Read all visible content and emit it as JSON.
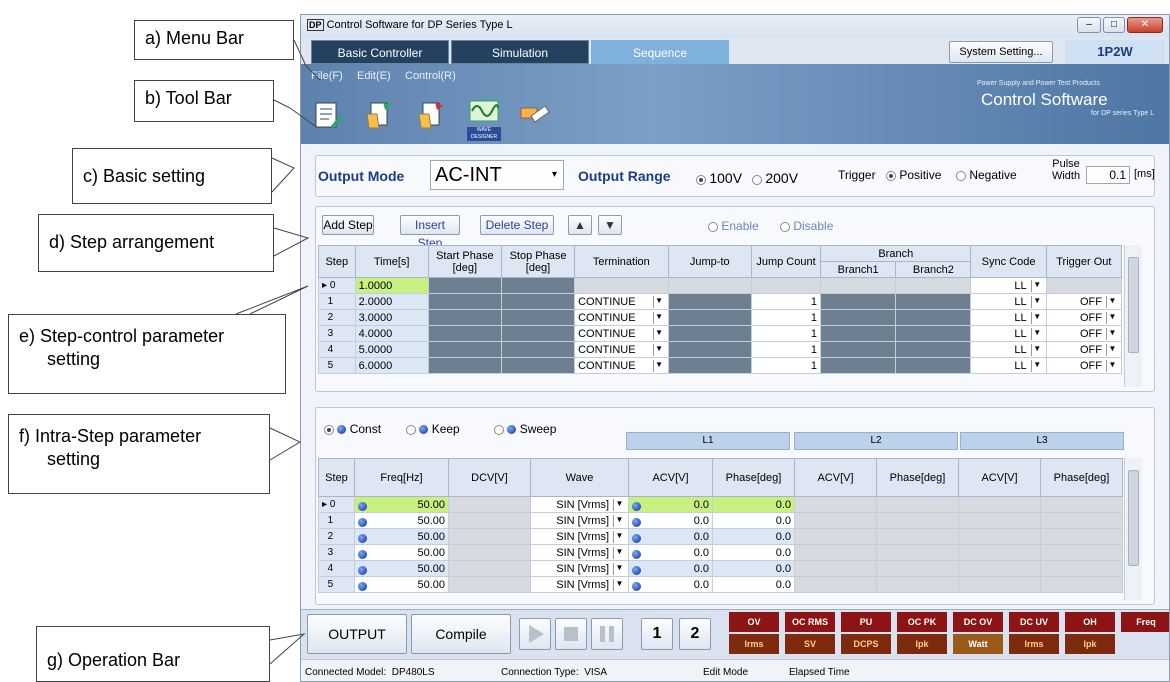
{
  "callouts": {
    "a": "a) Menu Bar",
    "b": "b) Tool Bar",
    "c": "c) Basic setting",
    "d": "d) Step arrangement",
    "e1": "e) Step-control parameter",
    "e2": "setting",
    "f1": "f) Intra-Step parameter",
    "f2": "setting",
    "g": "g) Operation Bar"
  },
  "window": {
    "title": "Control Software for DP Series Type L",
    "title_icon": "DP",
    "min": "–",
    "max": "□",
    "close": "✕"
  },
  "tabs": [
    "Basic Controller",
    "Simulation",
    "Sequence"
  ],
  "system_setting": "System Setting...",
  "phase_mode": "1P2W",
  "menu": [
    "File(F)",
    "Edit(E)",
    "Control(R)"
  ],
  "brand": {
    "small": "Power Supply and Power Test Products",
    "big": "Control Software",
    "sub": "for DP series Type L"
  },
  "tool_icons": [
    "edit-sheet-icon",
    "open-file-icon",
    "save-file-icon",
    "wave-designer-icon",
    "eraser-icon"
  ],
  "wave_designer_label": "WAVE DESIGNER",
  "basic": {
    "output_mode_label": "Output Mode",
    "output_mode_value": "AC-INT",
    "output_range_label": "Output Range",
    "range_100": "100V",
    "range_200": "200V",
    "trigger_label": "Trigger",
    "positive": "Positive",
    "negative": "Negative",
    "pulse_width_label": "Pulse Width",
    "pulse_width_value": "0.1",
    "pulse_unit": "[ms]"
  },
  "step_buttons": {
    "add": "Add Step",
    "insert": "Insert Step",
    "delete": "Delete Step",
    "up": "▲",
    "down": "▼",
    "enable": "Enable",
    "disable": "Disable"
  },
  "step_table": {
    "headers": [
      "Step",
      "Time[s]",
      "Start Phase [deg]",
      "Stop Phase [deg]",
      "Termination",
      "Jump-to",
      "Jump Count",
      "Branch",
      "Sync Code",
      "Trigger Out"
    ],
    "branch_sub": [
      "Branch1",
      "Branch2"
    ],
    "rows": [
      {
        "step": "0",
        "time": "1.0000",
        "term": "",
        "count": "",
        "sync": "LL",
        "trig": ""
      },
      {
        "step": "1",
        "time": "2.0000",
        "term": "CONTINUE",
        "count": "1",
        "sync": "LL",
        "trig": "OFF"
      },
      {
        "step": "2",
        "time": "3.0000",
        "term": "CONTINUE",
        "count": "1",
        "sync": "LL",
        "trig": "OFF"
      },
      {
        "step": "3",
        "time": "4.0000",
        "term": "CONTINUE",
        "count": "1",
        "sync": "LL",
        "trig": "OFF"
      },
      {
        "step": "4",
        "time": "5.0000",
        "term": "CONTINUE",
        "count": "1",
        "sync": "LL",
        "trig": "OFF"
      },
      {
        "step": "5",
        "time": "6.0000",
        "term": "CONTINUE",
        "count": "1",
        "sync": "LL",
        "trig": "OFF"
      }
    ]
  },
  "intra_modes": {
    "const": "Const",
    "keep": "Keep",
    "sweep": "Sweep"
  },
  "phase_groups": [
    "L1",
    "L2",
    "L3"
  ],
  "intra_table": {
    "headers": [
      "Step",
      "Freq[Hz]",
      "DCV[V]",
      "Wave",
      "ACV[V]",
      "Phase[deg]",
      "ACV[V]",
      "Phase[deg]",
      "ACV[V]",
      "Phase[deg]"
    ],
    "rows": [
      {
        "step": "0",
        "freq": "50.00",
        "wave": "SIN [Vrms]",
        "acv": "0.0",
        "phase": "0.0"
      },
      {
        "step": "1",
        "freq": "50.00",
        "wave": "SIN [Vrms]",
        "acv": "0.0",
        "phase": "0.0"
      },
      {
        "step": "2",
        "freq": "50.00",
        "wave": "SIN [Vrms]",
        "acv": "0.0",
        "phase": "0.0"
      },
      {
        "step": "3",
        "freq": "50.00",
        "wave": "SIN [Vrms]",
        "acv": "0.0",
        "phase": "0.0"
      },
      {
        "step": "4",
        "freq": "50.00",
        "wave": "SIN [Vrms]",
        "acv": "0.0",
        "phase": "0.0"
      },
      {
        "step": "5",
        "freq": "50.00",
        "wave": "SIN [Vrms]",
        "acv": "0.0",
        "phase": "0.0"
      }
    ]
  },
  "operation": {
    "output": "OUTPUT",
    "compile": "Compile",
    "mem1": "1",
    "mem2": "2"
  },
  "alarms_top": [
    "OV",
    "OC RMS",
    "PU",
    "OC PK",
    "DC OV",
    "DC UV",
    "OH",
    "Freq"
  ],
  "alarms_bottom": [
    "Irms",
    "SV",
    "DCPS",
    "Ipk",
    "Watt",
    "Irms",
    "Ipk"
  ],
  "status": {
    "model_label": "Connected Model:",
    "model": "DP480LS",
    "conn_label": "Connection Type:",
    "conn": "VISA",
    "edit": "Edit Mode",
    "elapsed": "Elapsed Time"
  }
}
